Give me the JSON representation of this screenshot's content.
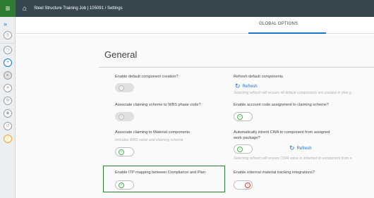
{
  "header": {
    "menu_icon": "≡",
    "home_icon": "⌂",
    "breadcrumb": "Steel Structure Training Job | 105091  /  Settings"
  },
  "tabs": {
    "active": "GLOBAL OPTIONS"
  },
  "section": {
    "title": "General"
  },
  "options": {
    "default_component": {
      "label": "Enable default component creation?"
    },
    "refresh_default": {
      "label": "Refresh default components",
      "action": "Refresh",
      "hint": "Selecting refresh will ensure all default components are created in plan g"
    },
    "claiming_wbs": {
      "label": "Associate claiming scheme to WBS phase code?"
    },
    "account_code": {
      "label": "Enable account code assignment to claiming scheme?"
    },
    "claiming_material": {
      "label": "Associate claiming to Material components",
      "hint": "Includes WBS value and claiming scheme"
    },
    "inherit_cwa": {
      "label": "Automatically inherit CWA to component from assigned",
      "label2": "work package?",
      "action": "Refresh",
      "hint": "Selecting refresh will ensure CWA value is inherited to component from a"
    },
    "itp_mapping": {
      "label": "Enable ITP mapping between Compliance and Plan"
    },
    "external_tracking": {
      "label": "Enable external material tracking integrations?"
    }
  },
  "colors": {
    "accent": "#1976d2",
    "brand_green": "#2e7d32",
    "topbar": "#37474f",
    "off_red": "#e53935"
  }
}
